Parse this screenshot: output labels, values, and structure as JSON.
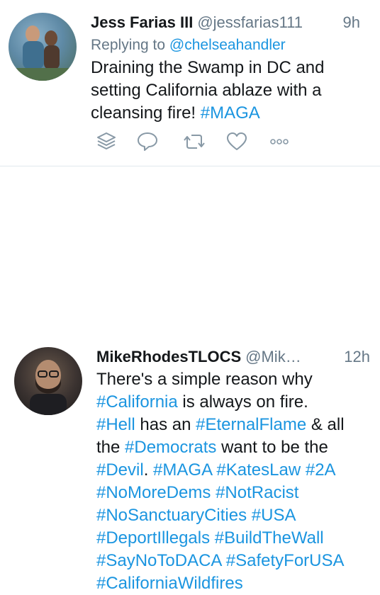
{
  "tweets": [
    {
      "name": "Jess Farias III",
      "handle": "@jessfarias111",
      "time": "9h",
      "reply_prefix": "Replying to",
      "reply_to": "@chelseahandler",
      "body_line1": "Draining the Swamp in DC and",
      "body_line2": "setting California ablaze with a",
      "body_line3a": "cleansing fire!",
      "body_line3_tag": "#MAGA",
      "actions": [
        "stack-icon",
        "reply-icon",
        "retweet-icon",
        "like-icon",
        "more-icon"
      ]
    },
    {
      "name": "MikeRhodesTLOCS",
      "handle": "@Mik…",
      "time": "12h",
      "l1": "There's a simple reason why",
      "l2_tag": "#California",
      "l2_text": " is always on fire.",
      "l3_tag1": "#Hell",
      "l3_text1": " has an ",
      "l3_tag2": "#EternalFlame",
      "l3_text2": " & all",
      "l4_text1": "the ",
      "l4_tag": "#Democrats",
      "l4_text2": " want to be the",
      "l5_tag1": "#Devil",
      "l5_text1": ". ",
      "l5_tag2": "#MAGA",
      "l5_tag3": "#KatesLaw",
      "l5_tag4": "#2A",
      "l6_tag1": "#NoMoreDems",
      "l6_tag2": "#NotRacist",
      "l7_tag1": "#NoSanctuaryCities",
      "l7_tag2": "#USA",
      "l8_tag1": "#DeportIllegals",
      "l8_tag2": "#BuildTheWall",
      "l9_tag1": "#SayNoToDACA",
      "l9_tag2": "#SafetyForUSA",
      "l10_tag": "#CaliforniaWildfires"
    }
  ],
  "colors": {
    "link": "#1b95e0",
    "muted": "#657786",
    "text": "#14171a",
    "divider": "#e1e8ed"
  }
}
